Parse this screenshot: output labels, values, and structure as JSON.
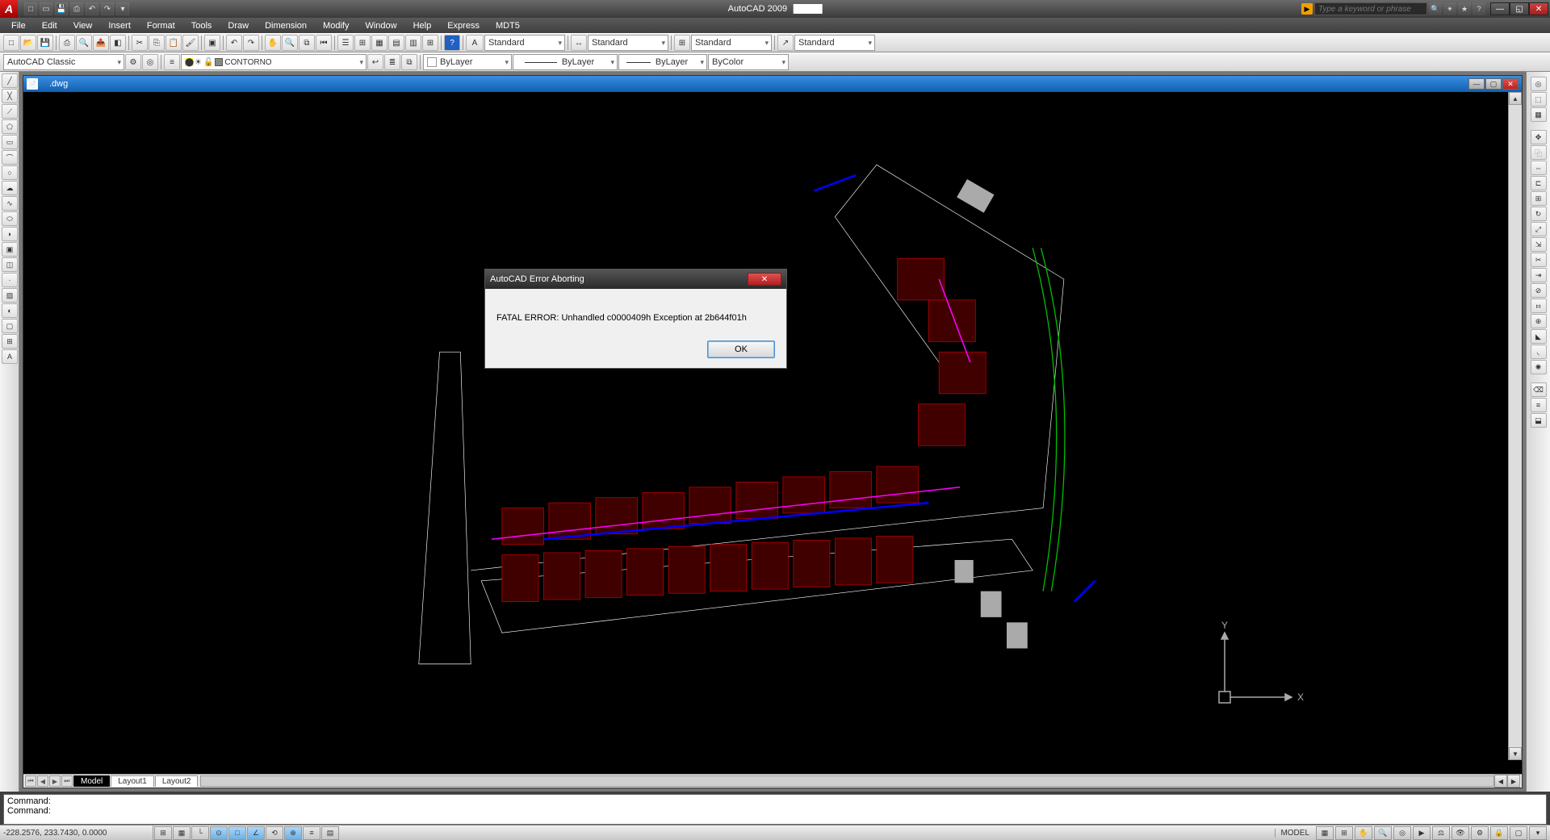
{
  "titlebar": {
    "app_name": "AutoCAD 2009",
    "doc_name": ".dwg",
    "search_placeholder": "Type a keyword or phrase"
  },
  "menubar": [
    "File",
    "Edit",
    "View",
    "Insert",
    "Format",
    "Tools",
    "Draw",
    "Dimension",
    "Modify",
    "Window",
    "Help",
    "Express",
    "MDT5"
  ],
  "toolbar1": {
    "workspace": "AutoCAD Classic",
    "layer_name": "CONTORNO"
  },
  "styles": {
    "text_style": "Standard",
    "dim_style": "Standard",
    "table_style": "Standard",
    "mleader_style": "Standard",
    "color": "ByLayer",
    "linetype": "ByLayer",
    "lineweight": "ByLayer",
    "plot_style": "ByColor"
  },
  "doc_window": {
    "title": ".dwg"
  },
  "tabs": {
    "active": "Model",
    "others": [
      "Layout1",
      "Layout2"
    ]
  },
  "ucs": {
    "x": "X",
    "y": "Y"
  },
  "cmdline": {
    "l1": "Command:",
    "l2": "Command:"
  },
  "status": {
    "coords": "-228.2576, 233.7430, 0.0000",
    "model_label": "MODEL"
  },
  "dialog": {
    "title": "AutoCAD Error Aborting",
    "message": "FATAL ERROR:  Unhandled c0000409h Exception at 2b644f01h",
    "ok": "OK"
  }
}
